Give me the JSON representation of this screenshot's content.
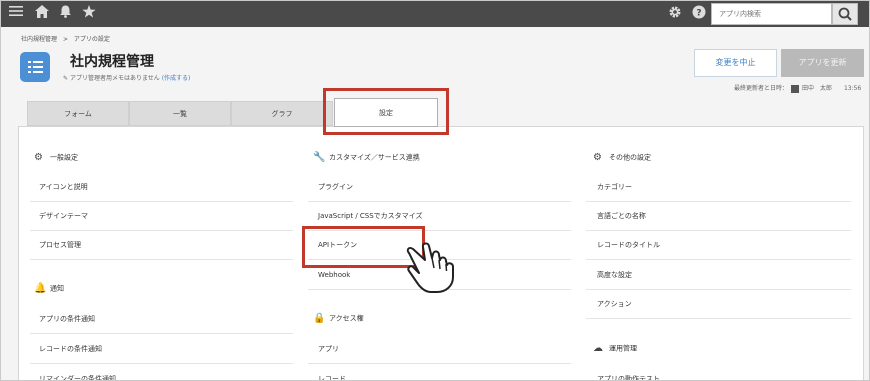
{
  "topbar": {
    "search_placeholder": "アプリ内検索"
  },
  "breadcrumb": {
    "home": "社内規程管理",
    "sep": ">",
    "current": "アプリの設定"
  },
  "header": {
    "title": "社内規程管理",
    "memo": "アプリ管理者用メモはありません",
    "memo_link": "(作成する)",
    "cancel_label": "変更を中止",
    "update_label": "アプリを更新",
    "updated_label": "最終更新者と日時：",
    "updated_user": "田中　太郎",
    "updated_time": "13:56"
  },
  "tabs": [
    "フォーム",
    "一覧",
    "グラフ",
    "設定"
  ],
  "columns": {
    "general": {
      "title": "一般設定",
      "items": [
        "アイコンと説明",
        "デザインテーマ",
        "プロセス管理"
      ]
    },
    "notify": {
      "title": "通知",
      "items": [
        "アプリの条件通知",
        "レコードの条件通知",
        "リマインダーの条件通知"
      ]
    },
    "customize": {
      "title": "カスタマイズ／サービス連携",
      "items": [
        "プラグイン",
        "JavaScript / CSSでカスタマイズ",
        "APIトークン",
        "Webhook"
      ]
    },
    "access": {
      "title": "アクセス権",
      "items": [
        "アプリ",
        "レコード"
      ]
    },
    "other": {
      "title": "その他の設定",
      "items": [
        "カテゴリー",
        "言語ごとの名称",
        "レコードのタイトル",
        "高度な設定",
        "アクション"
      ]
    },
    "ops": {
      "title": "運用管理",
      "items": [
        "アプリの動作テスト"
      ]
    }
  },
  "colors": {
    "highlight": "#c0392b",
    "accent": "#3d7fc4",
    "app_icon": "#4c8fd4"
  }
}
